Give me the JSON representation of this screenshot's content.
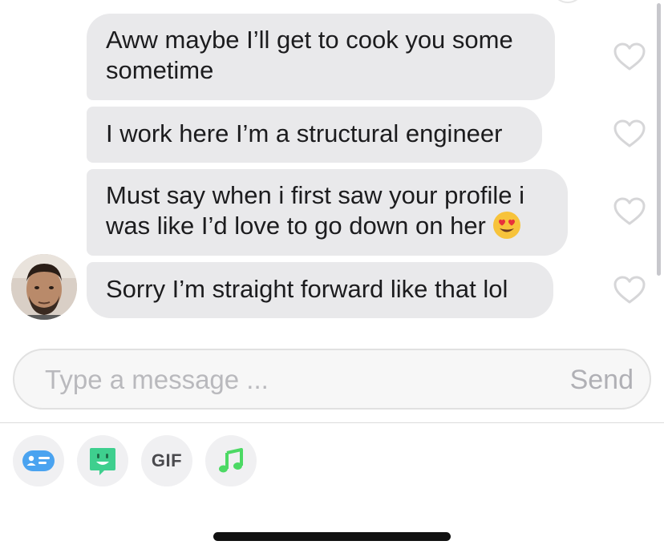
{
  "messages": [
    {
      "lines": [
        "Aww maybe I’ll get to cook you some",
        "sometime"
      ]
    },
    {
      "lines": [
        "I work here I’m a structural engineer"
      ]
    },
    {
      "lines": [
        "Must say when i first saw your profile i",
        "was like I’d love to go down on her"
      ],
      "emoji": "heart-eyes-emoji"
    },
    {
      "lines": [
        "Sorry I’m straight forward like that lol"
      ]
    }
  ],
  "composer": {
    "placeholder": "Type a message ...",
    "send_label": "Send"
  },
  "toolbar": {
    "items": [
      {
        "icon": "contact-card-icon",
        "color": "#4aa3f0"
      },
      {
        "icon": "sticker-face-icon",
        "color": "#3ecf8e"
      },
      {
        "icon": "gif-icon",
        "label": "GIF"
      },
      {
        "icon": "music-note-icon",
        "color": "#4cd964"
      }
    ]
  },
  "colors": {
    "bubble": "#e9e9eb",
    "text": "#1c1c1e",
    "placeholder": "#b9b9bd",
    "heart_outline": "#d6d6d8"
  }
}
